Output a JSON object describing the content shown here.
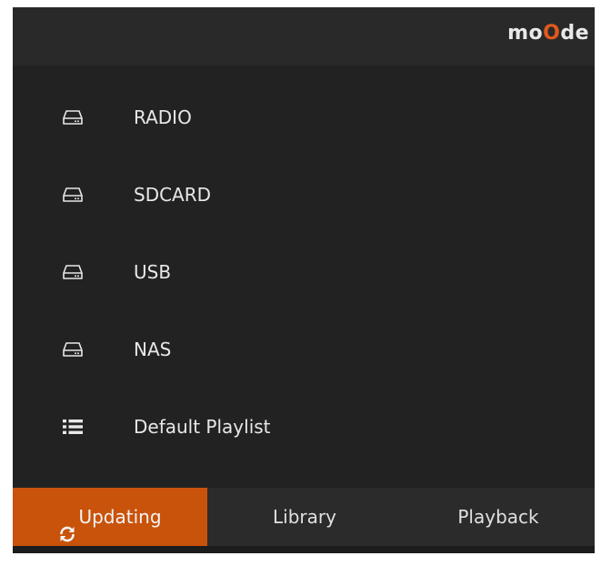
{
  "header": {
    "logo_pre": "mo",
    "logo_accent": "O",
    "logo_post": "de"
  },
  "sources": [
    {
      "label": "RADIO",
      "icon": "drive-icon"
    },
    {
      "label": "SDCARD",
      "icon": "drive-icon"
    },
    {
      "label": "USB",
      "icon": "drive-icon"
    },
    {
      "label": "NAS",
      "icon": "drive-icon"
    },
    {
      "label": "Default Playlist",
      "icon": "list-icon"
    }
  ],
  "footer": {
    "update_label": "Updating",
    "update_icon": "refresh-icon",
    "library_label": "Library",
    "playback_label": "Playback"
  },
  "colors": {
    "accent": "#c9530b",
    "logo_accent": "#e1591d",
    "background": "#222222",
    "header": "#292929",
    "footer": "#2b2b2b",
    "text": "#e8e8e8"
  }
}
